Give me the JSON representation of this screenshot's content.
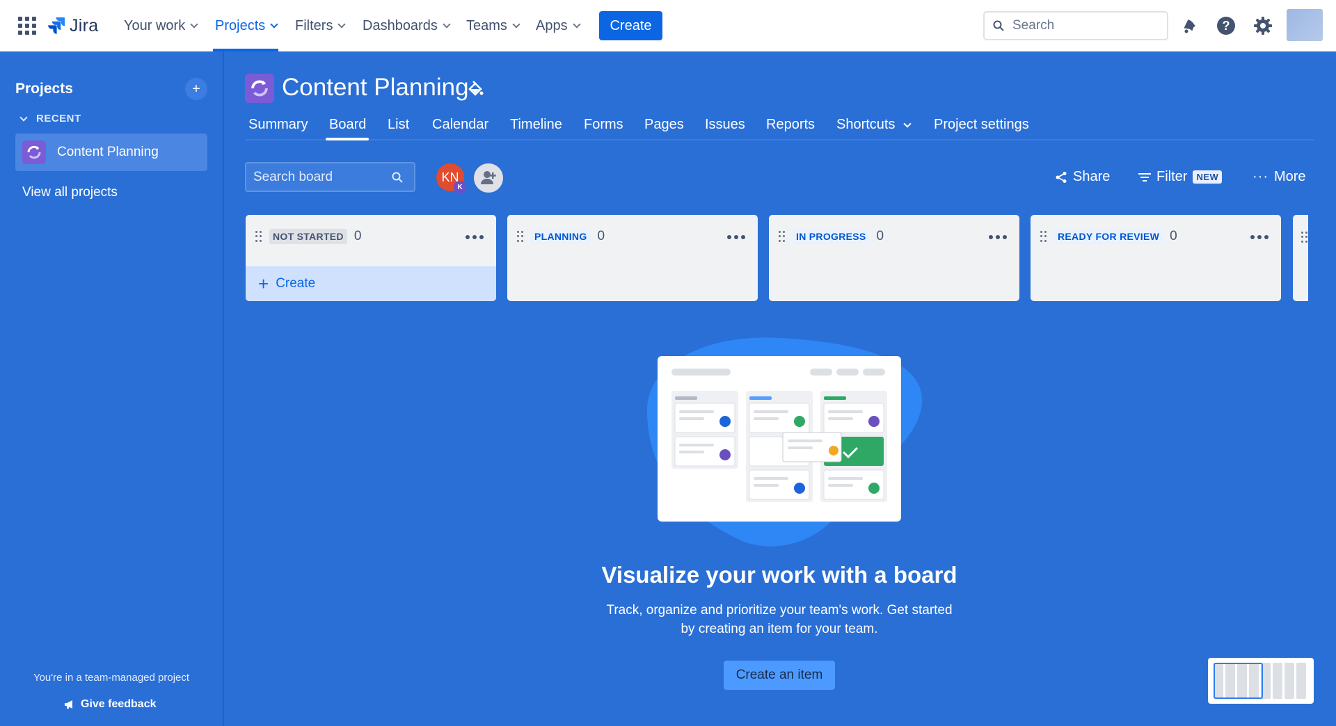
{
  "topnav": {
    "logo": "Jira",
    "items": [
      {
        "label": "Your work"
      },
      {
        "label": "Projects"
      },
      {
        "label": "Filters"
      },
      {
        "label": "Dashboards"
      },
      {
        "label": "Teams"
      },
      {
        "label": "Apps"
      }
    ],
    "active_item": "Projects",
    "create_label": "Create",
    "search_placeholder": "Search"
  },
  "sidebar": {
    "title": "Projects",
    "recent_label": "RECENT",
    "project": "Content Planning",
    "view_all": "View all projects",
    "team_managed": "You're in a team-managed project",
    "feedback": "Give feedback"
  },
  "project": {
    "title": "Content Planning",
    "tabs": [
      "Summary",
      "Board",
      "List",
      "Calendar",
      "Timeline",
      "Forms",
      "Pages",
      "Issues",
      "Reports",
      "Shortcuts",
      "Project settings"
    ],
    "active_tab": "Board"
  },
  "board": {
    "search_placeholder": "Search board",
    "avatar_initials": "KN",
    "avatar_badge": "K",
    "share": "Share",
    "filter": "Filter",
    "filter_badge": "NEW",
    "more": "More",
    "columns": [
      {
        "name": "NOT STARTED",
        "count": "0"
      },
      {
        "name": "PLANNING",
        "count": "0"
      },
      {
        "name": "IN PROGRESS",
        "count": "0"
      },
      {
        "name": "READY FOR REVIEW",
        "count": "0"
      }
    ],
    "column_create": "Create"
  },
  "empty_state": {
    "title": "Visualize your work with a board",
    "description": "Track, organize and prioritize your team's work. Get started by creating an item for your team.",
    "cta": "Create an item"
  },
  "colors": {
    "brand_blue": "#0c66e4",
    "page_bg": "#2a6fd6",
    "column_bg": "#f1f2f4"
  }
}
